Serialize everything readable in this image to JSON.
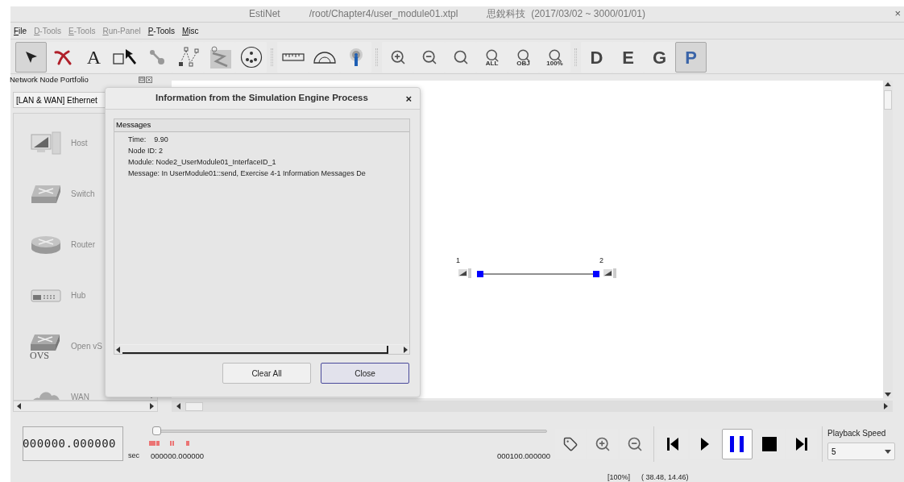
{
  "window": {
    "title": "EstiNet",
    "file_path": "/root/Chapter4/user_module01.xtpl",
    "license": "思銳科技  (2017/03/02 ~ 3000/01/01)",
    "close": "×"
  },
  "menu": [
    {
      "label": "File",
      "disabled": false
    },
    {
      "label": "D-Tools",
      "disabled": true
    },
    {
      "label": "E-Tools",
      "disabled": true
    },
    {
      "label": "Run-Panel",
      "disabled": true
    },
    {
      "label": "P-Tools",
      "disabled": false
    },
    {
      "label": "Misc",
      "disabled": false
    }
  ],
  "toolbar": [
    [
      {
        "kind": "select",
        "selected": true
      },
      {
        "kind": "delete",
        "selected": false
      },
      {
        "kind": "text",
        "label": "A",
        "selected": false
      },
      {
        "kind": "area-select",
        "selected": false
      },
      {
        "kind": "link",
        "selected": false
      },
      {
        "kind": "tree",
        "selected": false
      },
      {
        "kind": "map",
        "selected": false
      },
      {
        "kind": "group",
        "selected": false
      }
    ],
    [
      {
        "kind": "ruler",
        "selected": false
      },
      {
        "kind": "protractor",
        "selected": false
      },
      {
        "kind": "antenna",
        "selected": false
      }
    ],
    [
      {
        "kind": "zoom-in",
        "selected": false
      },
      {
        "kind": "zoom-out",
        "selected": false
      },
      {
        "kind": "zoom-fit",
        "selected": false
      },
      {
        "kind": "zoom-label",
        "label": "ALL",
        "selected": false
      },
      {
        "kind": "zoom-label",
        "label": "OBJ",
        "selected": false
      },
      {
        "kind": "zoom-label",
        "label": "100%",
        "selected": false
      }
    ],
    [
      {
        "kind": "letter",
        "label": "D",
        "selected": false
      },
      {
        "kind": "letter",
        "label": "E",
        "selected": false
      },
      {
        "kind": "letter",
        "label": "G",
        "selected": false
      },
      {
        "kind": "letter",
        "label": "P",
        "selected": true
      }
    ]
  ],
  "portfolio": {
    "title": "Network Node Portfolio",
    "category": "[LAN & WAN] Ethernet",
    "items": [
      {
        "kind": "host",
        "label": "Host"
      },
      {
        "kind": "switch",
        "label": "Switch"
      },
      {
        "kind": "router",
        "label": "Router"
      },
      {
        "kind": "hub",
        "label": "Hub"
      },
      {
        "kind": "ovs",
        "label": "Open vS",
        "badge": "OVS"
      },
      {
        "kind": "wan",
        "label": "WAN"
      }
    ]
  },
  "canvas": {
    "nodes": [
      {
        "label": "1"
      },
      {
        "label": "2"
      }
    ]
  },
  "dialog": {
    "title": "Information from the Simulation Engine Process",
    "close": "×",
    "messages_header": "Messages",
    "lines": [
      "Time:    9.90",
      "Node ID: 2",
      "Module: Node2_UserModule01_InterfaceID_1",
      "Message: In UserModule01::send, Exercise 4-1 Information Messages De"
    ],
    "buttons": [
      {
        "label": "Clear All",
        "default": false
      },
      {
        "label": "Close",
        "default": true
      }
    ]
  },
  "playback": {
    "time_display": "000000.000000",
    "unit": "sec",
    "slider": {
      "level": 0
    },
    "start": "000000.000000",
    "end": "000100.000000",
    "tools": [
      {
        "kind": "tag"
      },
      {
        "kind": "zoom-in"
      },
      {
        "kind": "zoom-out"
      }
    ],
    "controls": [
      {
        "kind": "skip-back",
        "selected": false
      },
      {
        "kind": "play",
        "selected": false
      },
      {
        "kind": "pause",
        "selected": true
      },
      {
        "kind": "stop",
        "selected": false
      },
      {
        "kind": "skip-forward",
        "selected": false
      }
    ],
    "speed_label": "Playback Speed",
    "speed": "5"
  },
  "status": {
    "zoom": "[100%]",
    "coordinates": "( 38.48, 14.46)"
  }
}
